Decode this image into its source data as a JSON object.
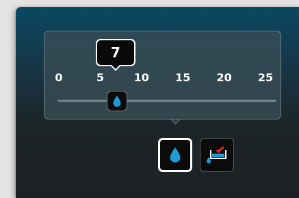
{
  "slider": {
    "ticks": [
      "0",
      "5",
      "10",
      "15",
      "20",
      "25"
    ],
    "min": 0,
    "max": 25,
    "value": 7,
    "value_label": "7",
    "thumb_icon": "water-drop-icon"
  },
  "mode_buttons": [
    {
      "icon": "water-drop-icon",
      "selected": true
    },
    {
      "icon": "tank-inflow-icon",
      "selected": false
    }
  ],
  "colors": {
    "accent": "#1e9bd7",
    "alert_red": "#d8262e",
    "panel_border": "#6d8189",
    "track": "#7a8589"
  }
}
